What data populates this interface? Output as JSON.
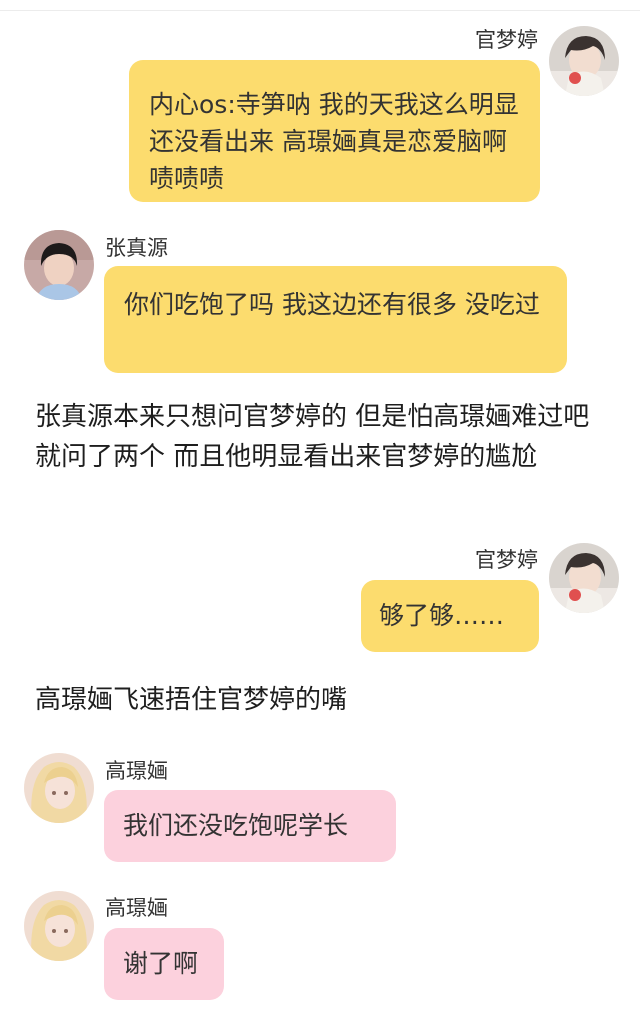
{
  "messages": [
    {
      "kind": "chat",
      "side": "right",
      "speaker": "官梦婷",
      "avatar": "avatar-guan",
      "bubble_color": "#fcdc6e",
      "text": "内心os:寺笋呐 我的天我这么明显还没看出来 高璟婳真是恋爱脑啊啧啧啧"
    },
    {
      "kind": "chat",
      "side": "left",
      "speaker": "张真源",
      "avatar": "avatar-zhang",
      "bubble_color": "#fcdc6e",
      "text": "你们吃饱了吗 我这边还有很多 没吃过"
    },
    {
      "kind": "narration",
      "text": "张真源本来只想问官梦婷的 但是怕高璟婳难过吧 就问了两个 而且他明显看出来官梦婷的尴尬"
    },
    {
      "kind": "chat",
      "side": "right",
      "speaker": "官梦婷",
      "avatar": "avatar-guan",
      "bubble_color": "#fcdc6e",
      "text": "够了够……"
    },
    {
      "kind": "narration",
      "text": "高璟婳飞速捂住官梦婷的嘴"
    },
    {
      "kind": "chat",
      "side": "left",
      "speaker": "高璟婳",
      "avatar": "avatar-gao",
      "bubble_color": "#fcd1dd",
      "text": "我们还没吃饱呢学长"
    },
    {
      "kind": "chat",
      "side": "left",
      "speaker": "高璟婳",
      "avatar": "avatar-gao",
      "bubble_color": "#fcd1dd",
      "text": "谢了啊"
    }
  ]
}
